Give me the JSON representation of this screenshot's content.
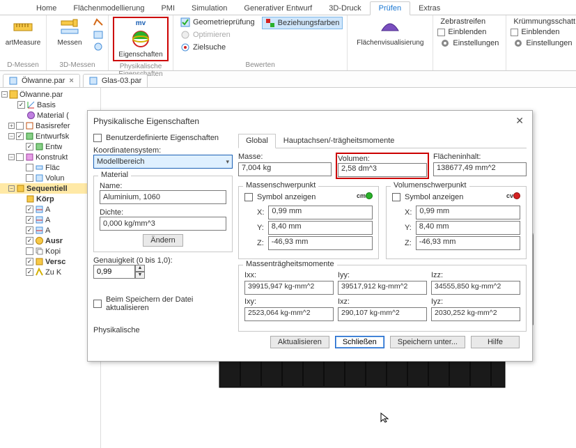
{
  "ribbon_tabs": {
    "home": "Home",
    "surface": "Flächenmodellierung",
    "pmi": "PMI",
    "simulation": "Simulation",
    "gen": "Generativer Entwurf",
    "print3d": "3D-Druck",
    "check": "Prüfen",
    "extras": "Extras"
  },
  "ribbon": {
    "group_dmessen": "D-Messen",
    "group_3dmessen": "3D-Messen",
    "group_phys": "Physikalische Eigenschaften",
    "group_bewerten": "Bewerten",
    "smart_measure_label": "artMeasure",
    "messen_label": "Messen",
    "eigenschaften_label": "Eigenschaften",
    "mv_label": "mv",
    "flaechenvis_label": "Flächenvisualisierung",
    "geometriepruefung": "Geometrieprüfung",
    "beziehungsfarben": "Beziehungsfarben",
    "optimieren": "Optimieren",
    "zielsuche": "Zielsuche",
    "zebra": "Zebrastreifen",
    "einblenden": "Einblenden",
    "einstellungen": "Einstellungen",
    "kruemmung": "Krümmungsschatt"
  },
  "docs": {
    "tab1": "Ölwanne.par",
    "tab2": "Glas-03.par"
  },
  "tree": {
    "root": "Ölwanne.par",
    "basis": "Basis",
    "material": "Material (",
    "basisref": "Basisrefer",
    "entwurf": "Entwurfsk",
    "entw_sub": "Entw",
    "konstrukt": "Konstrukt",
    "flae": "Fläc",
    "volun": "Volun",
    "sequentiell": "Sequentiell",
    "koerp": "Körp",
    "a_item": "A",
    "ausr": "Ausr",
    "kopi": "Kopi",
    "versc": "Versc",
    "zuk": "Zu K"
  },
  "dialog": {
    "title": "Physikalische Eigenschaften",
    "user_props": "Benutzerdefinierte Eigenschaften",
    "coord_label": "Koordinatensystem:",
    "coord_value": "Modellbereich",
    "material_legend": "Material",
    "name_label": "Name:",
    "name_value": "Aluminium, 1060",
    "density_label": "Dichte:",
    "density_value": "0,000 kg/mm^3",
    "change_btn": "Ändern",
    "accuracy_label": "Genauigkeit (0 bis 1,0):",
    "accuracy_value": "0,99",
    "save_update": "Beim Speichern der Datei aktualisieren",
    "phys_label": "Physikalische",
    "tab_global": "Global",
    "tab_axes": "Hauptachsen/-trägheitsmomente",
    "mass_label": "Masse:",
    "mass_value": "7,004 kg",
    "volume_label": "Volumen:",
    "volume_value": "2,58 dm^3",
    "area_label": "Flächeninhalt:",
    "area_value": "138677,49 mm^2",
    "com_legend": "Massenschwerpunkt",
    "cov_legend": "Volumenschwerpunkt",
    "sym_show": "Symbol anzeigen",
    "cm_tag": "cm",
    "cv_tag": "cv",
    "x_label": "X:",
    "y_label": "Y:",
    "z_label": "Z:",
    "com_x": "0,99 mm",
    "com_y": "8,40 mm",
    "com_z": "-46,93 mm",
    "cov_x": "0,99 mm",
    "cov_y": "8,40 mm",
    "cov_z": "-46,93 mm",
    "moments_legend": "Massenträgheitsmomente",
    "ixx_l": "Ixx:",
    "iyy_l": "Iyy:",
    "izz_l": "Izz:",
    "ixy_l": "Ixy:",
    "ixz_l": "Ixz:",
    "iyz_l": "Iyz:",
    "ixx": "39915,947 kg-mm^2",
    "iyy": "39517,912 kg-mm^2",
    "izz": "34555,850 kg-mm^2",
    "ixy": "2523,064 kg-mm^2",
    "ixz": "290,107 kg-mm^2",
    "iyz": "2030,252 kg-mm^2",
    "btn_update": "Aktualisieren",
    "btn_close": "Schließen",
    "btn_saveas": "Speichern unter...",
    "btn_help": "Hilfe"
  }
}
